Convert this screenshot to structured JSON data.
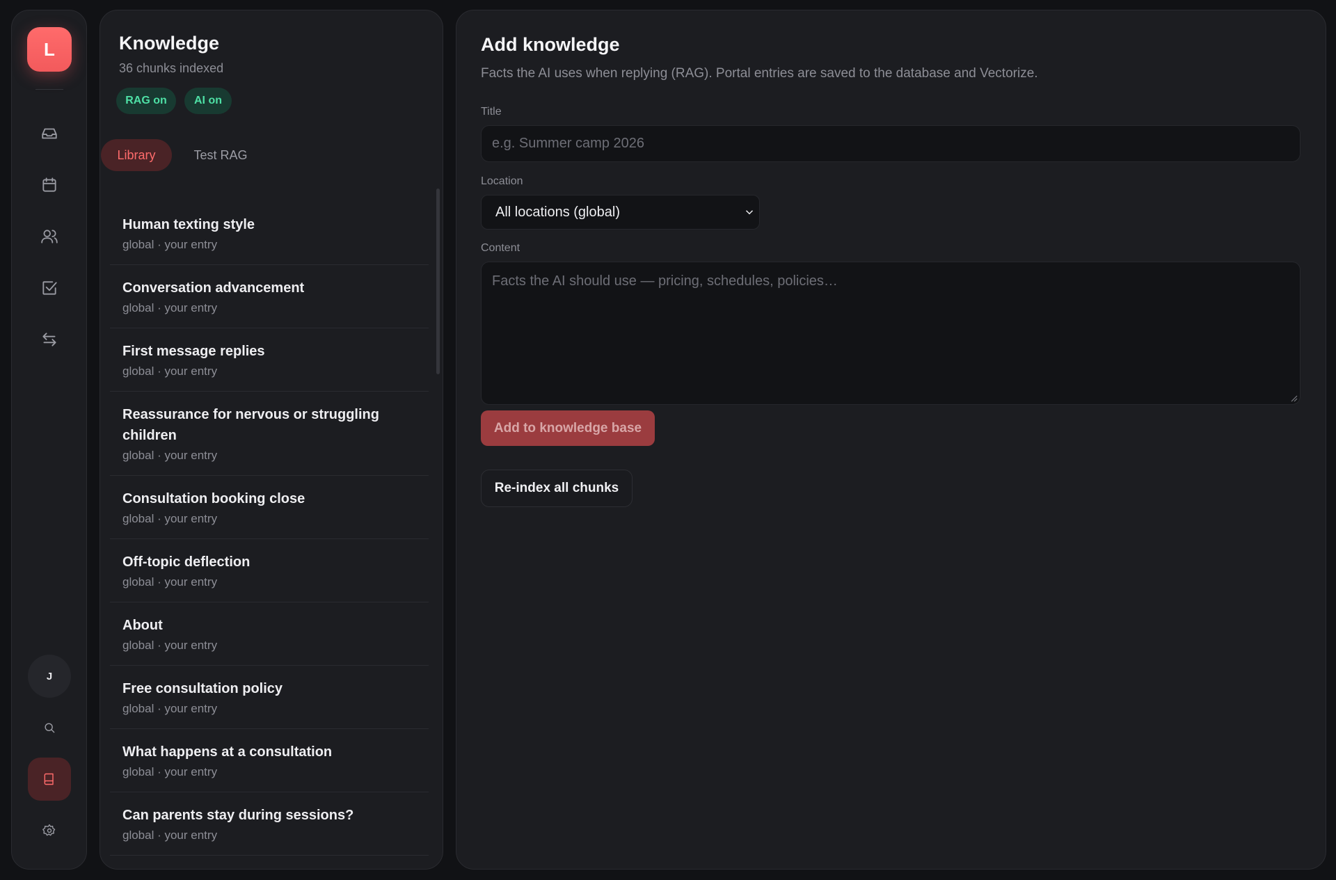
{
  "rail": {
    "logo_letter": "L",
    "avatar_initial": "J",
    "items": [
      {
        "icon": "inbox-icon"
      },
      {
        "icon": "calendar-icon"
      },
      {
        "icon": "users-icon"
      },
      {
        "icon": "check-square-icon"
      },
      {
        "icon": "transfer-icon"
      }
    ],
    "bottom": [
      {
        "icon": "search-icon"
      },
      {
        "icon": "book-icon",
        "active": true
      },
      {
        "icon": "gear-icon"
      }
    ],
    "accent_color": "#ff6b6b"
  },
  "knowledge": {
    "title": "Knowledge",
    "subtitle": "36 chunks indexed",
    "badges": [
      "RAG on",
      "AI on"
    ],
    "tabs": [
      {
        "label": "Library",
        "active": true
      },
      {
        "label": "Test RAG",
        "active": false
      }
    ],
    "items": [
      {
        "name": "Human texting style",
        "meta": "global · your entry"
      },
      {
        "name": "Conversation advancement",
        "meta": "global · your entry"
      },
      {
        "name": "First message replies",
        "meta": "global · your entry"
      },
      {
        "name": "Reassurance for nervous or struggling children",
        "meta": "global · your entry"
      },
      {
        "name": "Consultation booking close",
        "meta": "global · your entry"
      },
      {
        "name": "Off-topic deflection",
        "meta": "global · your entry"
      },
      {
        "name": "About",
        "meta": "global · your entry"
      },
      {
        "name": "Free consultation policy",
        "meta": "global · your entry"
      },
      {
        "name": "What happens at a consultation",
        "meta": "global · your entry"
      },
      {
        "name": "Can parents stay during sessions?",
        "meta": "global · your entry"
      }
    ]
  },
  "form": {
    "title": "Add knowledge",
    "description": "Facts the AI uses when replying (RAG). Portal entries are saved to the database and Vectorize.",
    "title_label": "Title",
    "title_placeholder": "e.g. Summer camp 2026",
    "location_label": "Location",
    "location_value": "All locations (global)",
    "content_label": "Content",
    "content_placeholder": "Facts the AI should use — pricing, schedules, policies…",
    "add_button": "Add to knowledge base",
    "reindex_button": "Re-index all chunks"
  }
}
